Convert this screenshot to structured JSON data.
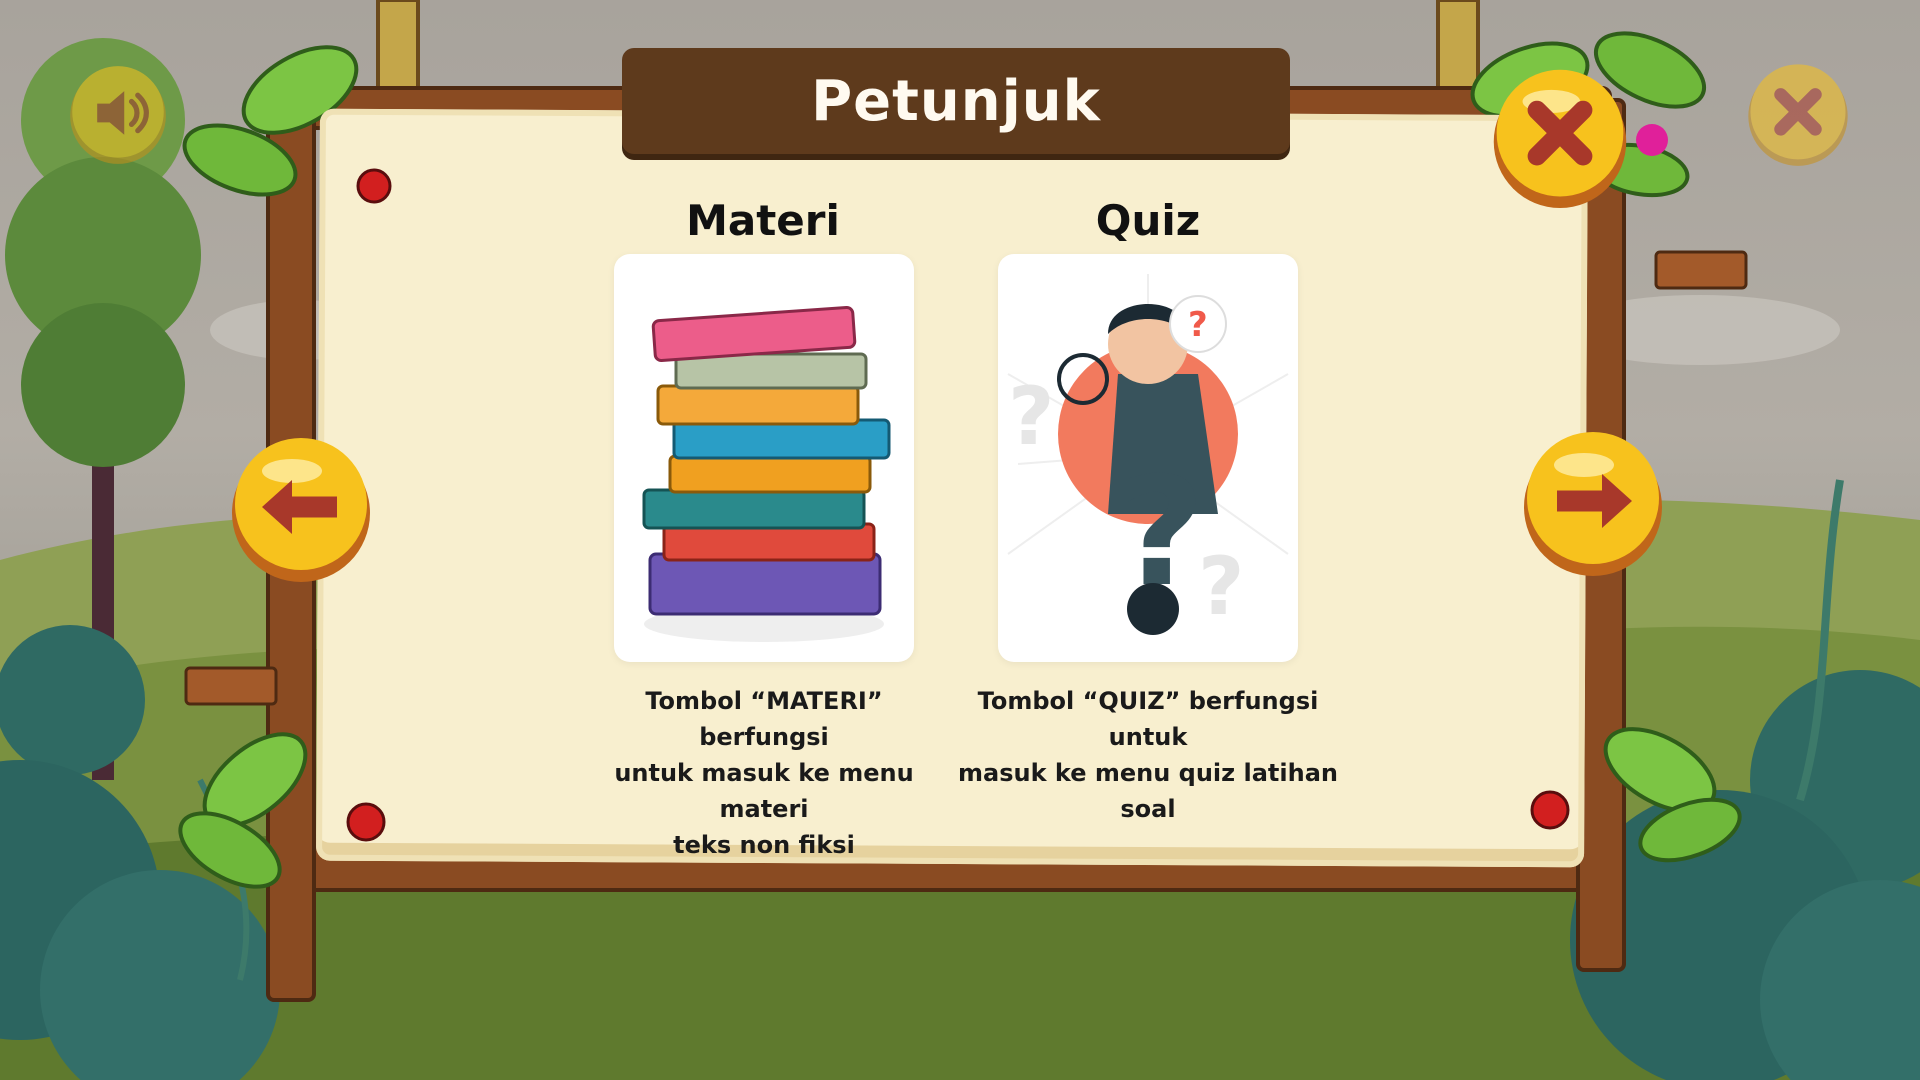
{
  "header": {
    "title": "Petunjuk"
  },
  "buttons": {
    "sound": {
      "icon": "speaker-icon"
    },
    "close_corner": {
      "icon": "close-icon"
    },
    "close_board": {
      "icon": "close-icon"
    },
    "prev": {
      "icon": "arrow-left-icon"
    },
    "next": {
      "icon": "arrow-right-icon"
    }
  },
  "cards": [
    {
      "heading": "Materi",
      "image": "book-stack-illustration",
      "desc_lines": [
        "Tombol “MATERI” berfungsi",
        "untuk masuk ke menu materi",
        "teks non fiksi"
      ]
    },
    {
      "heading": "Quiz",
      "image": "thinking-man-question-illustration",
      "desc_lines": [
        "Tombol “QUIZ” berfungsi untuk",
        "masuk ke menu quiz latihan",
        "soal"
      ]
    }
  ],
  "colors": {
    "board": "#f8efcf",
    "title_bar": "#5e3a1c",
    "button_yellow": "#f7c21d",
    "button_icon": "#a8382a",
    "wood": "#8a4b22"
  }
}
